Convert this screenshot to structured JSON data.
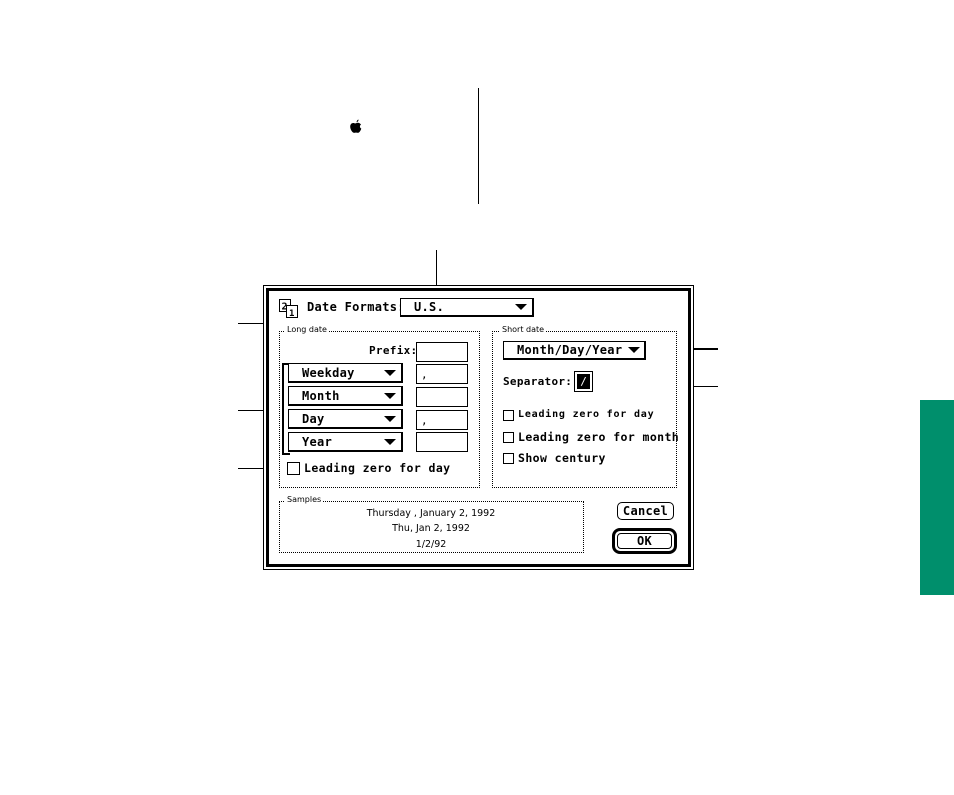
{
  "colors": {
    "side_tab": "#008f6c"
  },
  "icons": {
    "apple": "apple-logo-icon",
    "date_formats": "date-formats-icon",
    "popup_arrow": "triangle-down-icon"
  },
  "dialog": {
    "icon_glyph_top": "2",
    "icon_glyph_bottom": "1",
    "title_label": "Date Formats:",
    "format_popup": {
      "value": "U.S."
    },
    "long_date": {
      "title": "Long date",
      "prefix_label": "Prefix:",
      "prefix_value": "",
      "rows": [
        {
          "popup": "Weekday",
          "separator": ","
        },
        {
          "popup": "Month",
          "separator": ""
        },
        {
          "popup": "Day",
          "separator": ","
        },
        {
          "popup": "Year",
          "separator": ""
        }
      ],
      "leading_zero_day": {
        "label": "Leading zero for day",
        "checked": false
      }
    },
    "short_date": {
      "title": "Short date",
      "order_popup": {
        "value": "Month/Day/Year"
      },
      "separator_label": "Separator:",
      "separator_value": "/",
      "checkboxes": [
        {
          "label": "Leading zero for day",
          "checked": false
        },
        {
          "label": "Leading zero for month",
          "checked": false
        },
        {
          "label": "Show century",
          "checked": false
        }
      ]
    },
    "samples": {
      "title": "Samples",
      "lines": [
        "Thursday , January 2, 1992",
        "Thu, Jan 2, 1992",
        "1/2/92"
      ]
    },
    "buttons": {
      "cancel": "Cancel",
      "ok": "OK"
    }
  }
}
